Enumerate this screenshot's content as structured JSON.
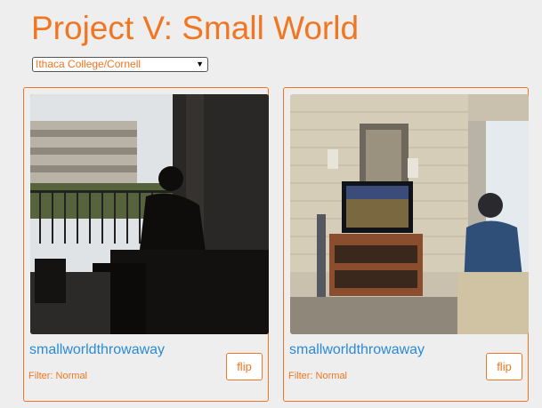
{
  "page": {
    "title": "Project V: Small World"
  },
  "location_select": {
    "selected": "Ithaca College/Cornell"
  },
  "colors": {
    "accent": "#f07622",
    "link": "#2a8ad4",
    "background": "#eeeeee"
  },
  "cards": [
    {
      "image": "photo of a person sitting in a dark lounge by a window playing a video game",
      "username": "smallworldthrowaway",
      "filter_label": "Filter: Normal",
      "flip_label": "flip"
    },
    {
      "image": "photo of a person playing a video game on a TV in a dorm room",
      "username": "smallworldthrowaway",
      "filter_label": "Filter: Normal",
      "flip_label": "flip"
    }
  ]
}
